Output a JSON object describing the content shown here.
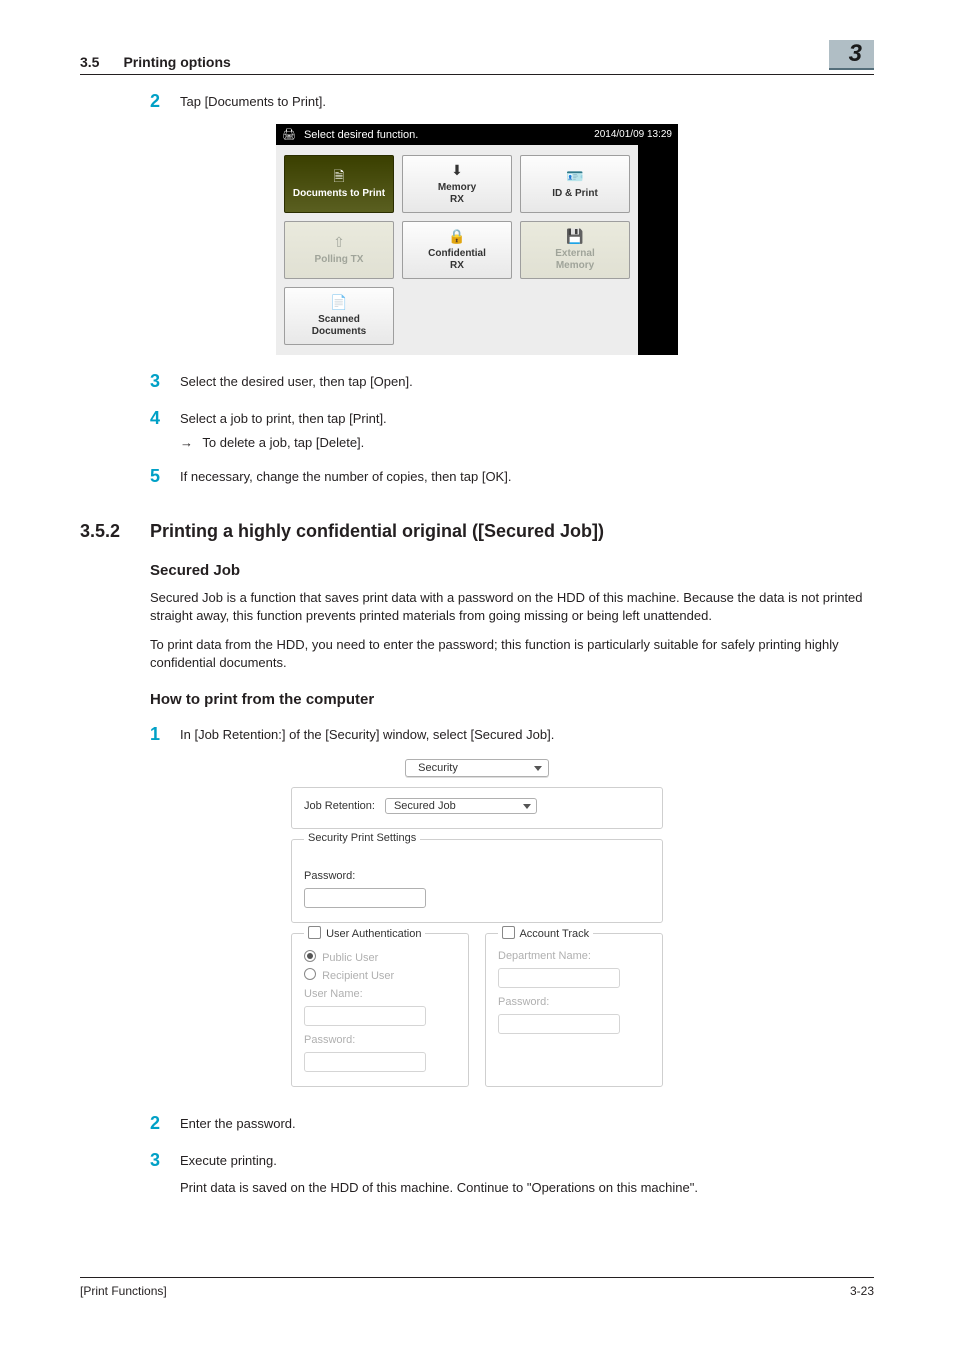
{
  "header": {
    "section_no": "3.5",
    "section_title": "Printing options",
    "chapter": "3"
  },
  "steps_a": {
    "s2": "Tap [Documents to Print].",
    "s3": "Select the desired user, then tap [Open].",
    "s4": "Select a job to print, then tap [Print].",
    "s4_bullet": "To delete a job, tap [Delete].",
    "s5": "If necessary, change the number of copies, then tap [OK]."
  },
  "screenshot1": {
    "prompt": "Select desired function.",
    "clock": "2014/01/09 13:29",
    "tiles": {
      "t1": "Documents to Print",
      "t2": "Memory\nRX",
      "t3": "ID & Print",
      "t4": "Polling TX",
      "t5": "Confidential\nRX",
      "t6": "External\nMemory",
      "t7": "Scanned\nDocuments"
    }
  },
  "section_352": {
    "num": "3.5.2",
    "title": "Printing a highly confidential original ([Secured Job])"
  },
  "secured_job": {
    "heading": "Secured Job",
    "p1": "Secured Job is a function that saves print data with a password on the HDD of this machine. Because the data is not printed straight away, this function prevents printed materials from going missing or being left unattended.",
    "p2": "To print data from the HDD, you need to enter the password; this function is particularly suitable for safely printing highly confidential documents."
  },
  "how_to": {
    "heading": "How to print from the computer",
    "s1": "In [Job Retention:] of the [Security] window, select [Secured Job].",
    "s2": "Enter the password.",
    "s3": "Execute printing.",
    "s3_sub": "Print data is saved on the HDD of this machine. Continue to \"Operations on this machine\"."
  },
  "screenshot2": {
    "tab": "Security",
    "retention_label": "Job Retention:",
    "retention_value": "Secured Job",
    "sps_legend": "Security Print Settings",
    "password_label": "Password:",
    "ua_legend": "User Authentication",
    "ua_public": "Public User",
    "ua_recipient": "Recipient User",
    "ua_username": "User Name:",
    "ua_password": "Password:",
    "at_legend": "Account Track",
    "at_dept": "Department Name:",
    "at_password": "Password:"
  },
  "footer": {
    "left": "[Print Functions]",
    "right": "3-23"
  }
}
